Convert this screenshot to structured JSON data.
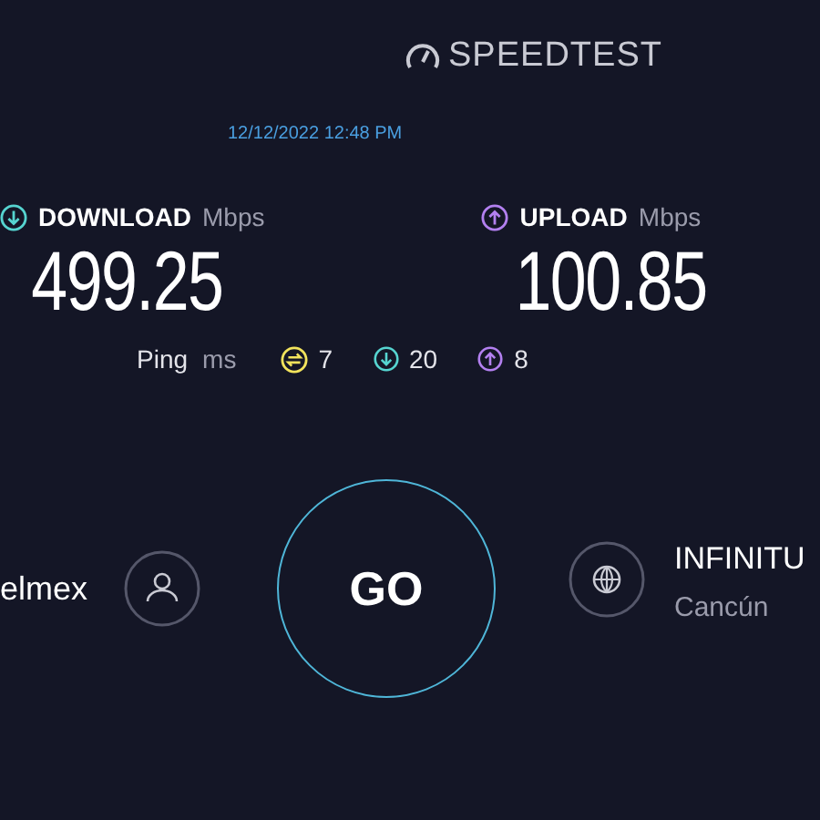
{
  "brand": {
    "name": "SPEEDTEST"
  },
  "timestamp": "12/12/2022 12:48 PM",
  "results": [
    {
      "kind": "download",
      "label": "DOWNLOAD",
      "unit": "Mbps",
      "value": "499.25"
    },
    {
      "kind": "upload",
      "label": "UPLOAD",
      "unit": "Mbps",
      "value": "100.85"
    }
  ],
  "ping": {
    "label": "Ping",
    "unit": "ms",
    "idle": "7",
    "download": "20",
    "upload": "8"
  },
  "provider": {
    "name": "elmex"
  },
  "go_button": "GO",
  "server": {
    "name": "INFINITU",
    "location": "Cancún"
  }
}
